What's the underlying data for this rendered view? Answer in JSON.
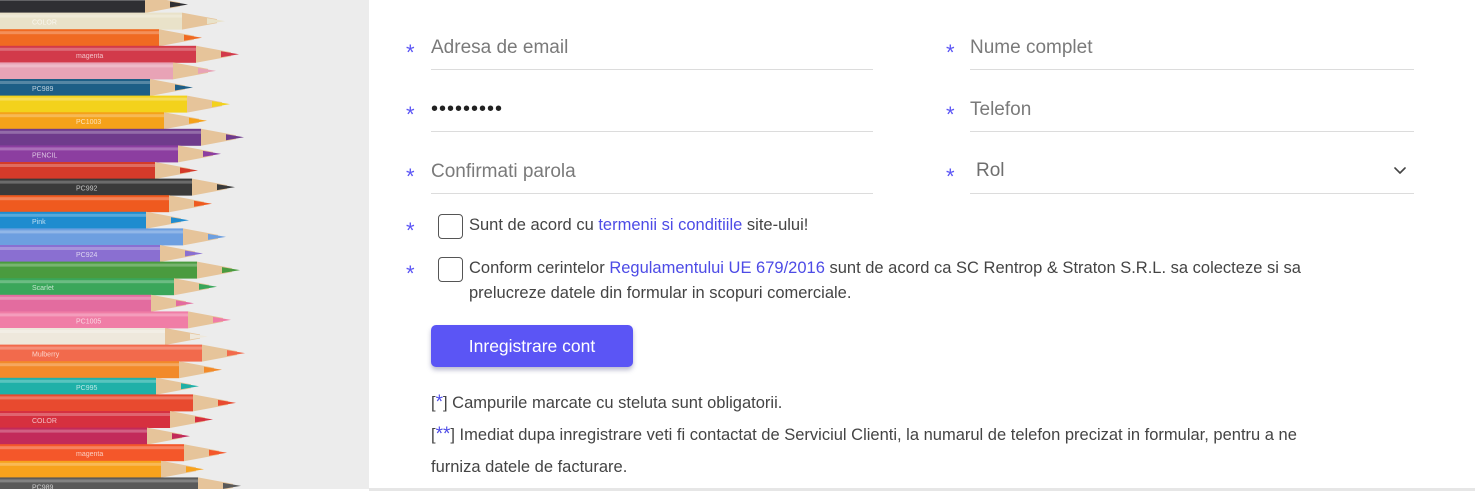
{
  "form": {
    "email_placeholder": "Adresa de email",
    "fullname_placeholder": "Nume complet",
    "password_value": "123456789",
    "phone_placeholder": "Telefon",
    "confirm_placeholder": "Confirmati parola",
    "role_selected": "Rol",
    "required_marker": "*"
  },
  "consent1": {
    "pre": "Sunt de acord cu ",
    "link": "termenii si conditiile",
    "post": " site-ului!"
  },
  "consent2": {
    "pre": "Conform cerintelor ",
    "link": "Regulamentului UE 679/2016",
    "post": " sunt de acord ca SC Rentrop & Straton S.R.L. sa colecteze si sa",
    "line2": "prelucreze datele din formular in scopuri comerciale."
  },
  "submit_label": "Inregistrare cont",
  "notes": {
    "note1_open": "[",
    "note1_star": "*",
    "note1_text": "] Campurile marcate cu steluta sunt obligatorii.",
    "note2_open": "[",
    "note2_star": "**",
    "note2_text": "] Imediat dupa inregistrare veti fi contactat de Serviciul Clienti, la numarul de telefon precizat in formular, pentru a ne",
    "note2_line2": "furniza datele de facturare."
  },
  "colors": {
    "accent": "#5b55f5",
    "link": "#4d4be6"
  },
  "photo": {
    "pencil_labels": [
      "COLOR",
      "magenta",
      "PC989",
      "PC1003",
      "PENCIL",
      "PC992",
      "Pink",
      "PC924",
      "Scarlet",
      "PC1005",
      "Mulberry",
      "PC995"
    ]
  }
}
